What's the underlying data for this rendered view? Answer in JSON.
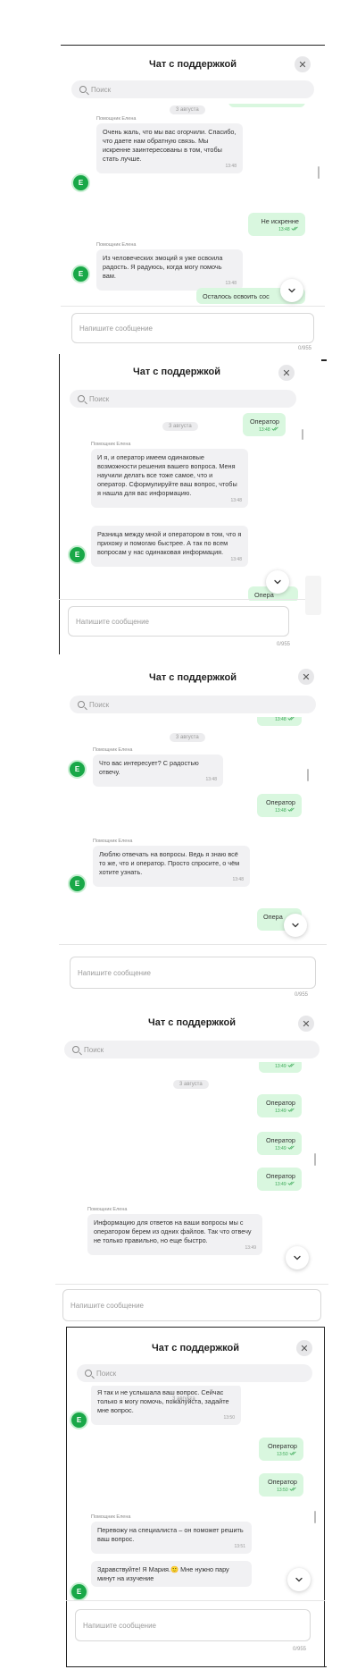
{
  "header": {
    "title": "Чат с поддержкой"
  },
  "search": {
    "placeholder": "Поиск"
  },
  "input": {
    "placeholder": "Напишите сообщение"
  },
  "counter": "0/955",
  "date_label": "3 августа",
  "sender": "Помощник Елена",
  "avatar_letter": "Е",
  "screens": [
    {
      "messages": [
        {
          "text": "Очень жаль, что мы вас огорчили. Спасибо, что даете нам обратную связь. Мы искренне заинтересованы в том, чтобы стать лучше.",
          "time": "13:48"
        },
        {
          "text": "Не искренне",
          "time": "13:48"
        },
        {
          "text": "Из человеческих эмоций я уже освоила радость. Я радуюсь, когда могу помочь вам.",
          "time": "13:48"
        },
        {
          "text": "Осталось освоить сос",
          "time": "13:48"
        }
      ]
    },
    {
      "messages": [
        {
          "text": "Оператор",
          "time": "13:48"
        },
        {
          "text": "И я, и оператор имеем одинаковые возможности решения вашего вопроса. Меня научили делать все тоже самое, что и оператор. Сформулируйте ваш вопрос, чтобы я нашла для вас информацию.",
          "time": "13:48"
        },
        {
          "text": "Разница между мной и оператором в том, что я прихожу и помогаю быстрее. А так по всем вопросам у нас одинаковая информация.",
          "time": "13:48"
        },
        {
          "text": "Опера",
          "time": ""
        }
      ]
    },
    {
      "messages": [
        {
          "text": "",
          "time": "13:48"
        },
        {
          "text": "Что вас интересует? С радостью отвечу.",
          "time": "13:48"
        },
        {
          "text": "Оператор",
          "time": "13:48"
        },
        {
          "text": "Люблю отвечать на вопросы. Ведь я знаю всё то же, что и оператор. Просто спросите, о чём хотите узнать.",
          "time": "13:48"
        },
        {
          "text": "Опера",
          "time": "13:"
        }
      ]
    },
    {
      "messages": [
        {
          "text": "",
          "time": "13:49"
        },
        {
          "text": "Оператор",
          "time": "13:49"
        },
        {
          "text": "Оператор",
          "time": "13:49"
        },
        {
          "text": "Оператор",
          "time": "13:49"
        },
        {
          "text": "Информацию для ответов на ваши вопросы мы с оператором берем из одних файлов. Так что отвечу не только правильно, но еще быстро.",
          "time": "13:49"
        }
      ]
    },
    {
      "messages": [
        {
          "text": "Я так и не услышала ваш вопрос. Сейчас только я могу помочь, пожалуйста, задайте мне вопрос.",
          "time": "13:50"
        },
        {
          "text": "Оператор",
          "time": "13:50"
        },
        {
          "text": "Оператор",
          "time": "13:50"
        },
        {
          "text": "Перевожу на специалиста – он поможет решить ваш вопрос.",
          "time": "13:51"
        },
        {
          "text": "Здравствуйте! Я Мария.🙂 Мне нужно пару минут на изучение",
          "time": ""
        }
      ]
    }
  ]
}
